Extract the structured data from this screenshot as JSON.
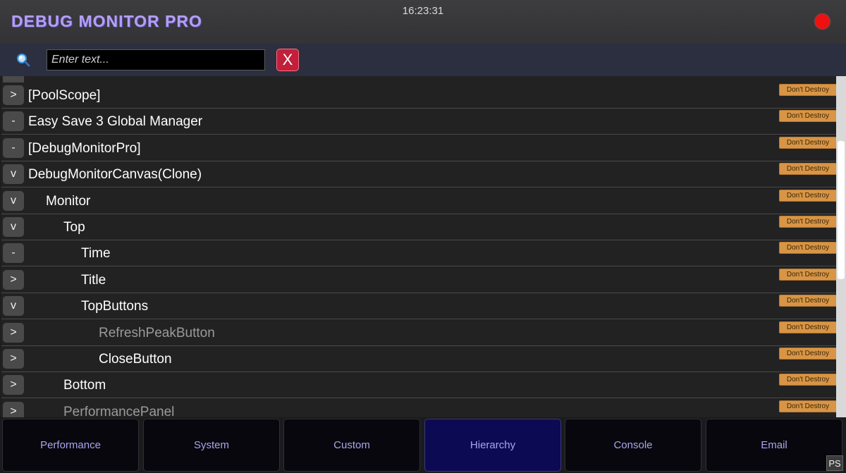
{
  "header": {
    "title": "DEBUG MONITOR PRO",
    "time": "16:23:31",
    "record_indicator_color": "#ee1111"
  },
  "search": {
    "icon": "search-icon",
    "placeholder": "Enter text...",
    "value": "",
    "clear_label": "X"
  },
  "hierarchy": {
    "badge_text": "Don't Destroy",
    "rows": [
      {
        "toggle": ">",
        "label": "[PoolScope]",
        "depth": 0,
        "active": true
      },
      {
        "toggle": "-",
        "label": "Easy Save 3 Global Manager",
        "depth": 0,
        "active": true
      },
      {
        "toggle": "-",
        "label": "[DebugMonitorPro]",
        "depth": 0,
        "active": true
      },
      {
        "toggle": "v",
        "label": "DebugMonitorCanvas(Clone)",
        "depth": 0,
        "active": true
      },
      {
        "toggle": "v",
        "label": "Monitor",
        "depth": 1,
        "active": true
      },
      {
        "toggle": "v",
        "label": "Top",
        "depth": 2,
        "active": true
      },
      {
        "toggle": "-",
        "label": "Time",
        "depth": 3,
        "active": true
      },
      {
        "toggle": ">",
        "label": "Title",
        "depth": 3,
        "active": true
      },
      {
        "toggle": "v",
        "label": "TopButtons",
        "depth": 3,
        "active": true
      },
      {
        "toggle": ">",
        "label": "RefreshPeakButton",
        "depth": 4,
        "active": false
      },
      {
        "toggle": ">",
        "label": "CloseButton",
        "depth": 4,
        "active": true
      },
      {
        "toggle": ">",
        "label": "Bottom",
        "depth": 2,
        "active": true
      },
      {
        "toggle": ">",
        "label": "PerformancePanel",
        "depth": 2,
        "active": false
      }
    ]
  },
  "tabs": [
    {
      "label": "Performance",
      "active": false
    },
    {
      "label": "System",
      "active": false
    },
    {
      "label": "Custom",
      "active": false
    },
    {
      "label": "Hierarchy",
      "active": true
    },
    {
      "label": "Console",
      "active": false
    },
    {
      "label": "Email",
      "active": false
    }
  ],
  "corner_badge": "PS",
  "colors": {
    "title": "#b3a0f0",
    "badge": "#d89545",
    "active_tab": "#0c0a52",
    "clear_button": "#c11f3a"
  }
}
